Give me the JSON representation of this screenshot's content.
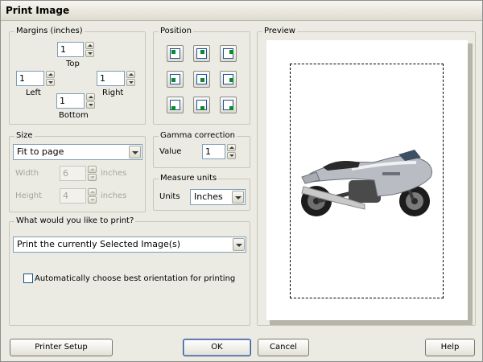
{
  "window": {
    "title": "Print Image"
  },
  "margins": {
    "group_label": "Margins (inches)",
    "top_label": "Top",
    "top_value": "1",
    "left_label": "Left",
    "left_value": "1",
    "right_label": "Right",
    "right_value": "1",
    "bottom_label": "Bottom",
    "bottom_value": "1"
  },
  "position": {
    "group_label": "Position",
    "buttons": [
      "top-left",
      "top-center",
      "top-right",
      "middle-left",
      "center",
      "middle-right",
      "bottom-left",
      "bottom-center",
      "bottom-right"
    ]
  },
  "size": {
    "group_label": "Size",
    "mode": "Fit to page",
    "width_label": "Width",
    "width_value": "6",
    "width_unit": "inches",
    "height_label": "Height",
    "height_value": "4",
    "height_unit": "inches"
  },
  "gamma": {
    "group_label": "Gamma correction",
    "value_label": "Value",
    "value": "1"
  },
  "measure": {
    "group_label": "Measure units",
    "units_label": "Units",
    "units_value": "Inches"
  },
  "print_what": {
    "group_label": "What would you like to print?",
    "selected": "Print the currently Selected Image(s)",
    "auto_orientation_label": "Automatically choose best orientation for printing",
    "auto_orientation_checked": false
  },
  "preview": {
    "group_label": "Preview"
  },
  "buttons": {
    "printer_setup": "Printer Setup",
    "ok": "OK",
    "cancel": "Cancel",
    "help": "Help"
  }
}
